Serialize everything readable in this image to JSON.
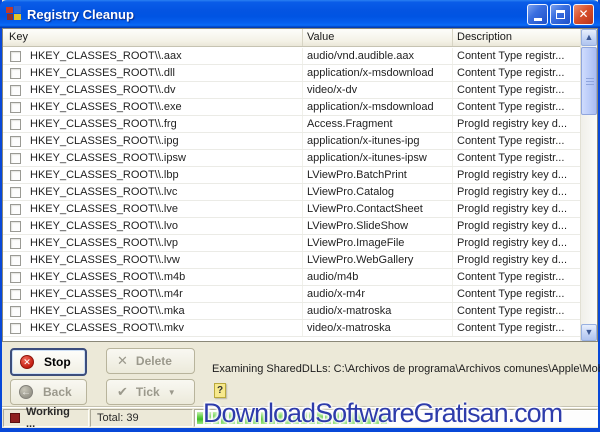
{
  "window": {
    "title": "Registry Cleanup"
  },
  "colors": {
    "titlebar_blue": "#0054e3",
    "window_border_blue": "#0848d8",
    "client_beige": "#ece9d8",
    "progress_green": "#46c42e",
    "close_button_red": "#d9512d",
    "watermark_blue": "#2e3cab",
    "working_dot_red": "#8e1f1f"
  },
  "icons": {
    "title_icon": "registry-blocks",
    "minimize": "minimize-icon",
    "maximize": "maximize-icon",
    "close_glyph": "✕",
    "stop_glyph": "✕",
    "back_glyph": "←",
    "delete_glyph": "✕",
    "tick_glyph": "✔",
    "tick_dropdown_glyph": "▼",
    "scroll_up_glyph": "▲",
    "scroll_down_glyph": "▼",
    "help_glyph": "?"
  },
  "table": {
    "columns": [
      "Key",
      "Value",
      "Description"
    ],
    "rows": [
      {
        "key": "HKEY_CLASSES_ROOT\\\\.aax",
        "value": "audio/vnd.audible.aax",
        "desc": "Content Type registr..."
      },
      {
        "key": "HKEY_CLASSES_ROOT\\\\.dll",
        "value": "application/x-msdownload",
        "desc": "Content Type registr..."
      },
      {
        "key": "HKEY_CLASSES_ROOT\\\\.dv",
        "value": "video/x-dv",
        "desc": "Content Type registr..."
      },
      {
        "key": "HKEY_CLASSES_ROOT\\\\.exe",
        "value": "application/x-msdownload",
        "desc": "Content Type registr..."
      },
      {
        "key": "HKEY_CLASSES_ROOT\\\\.frg",
        "value": "Access.Fragment",
        "desc": "ProgId registry key d..."
      },
      {
        "key": "HKEY_CLASSES_ROOT\\\\.ipg",
        "value": "application/x-itunes-ipg",
        "desc": "Content Type registr..."
      },
      {
        "key": "HKEY_CLASSES_ROOT\\\\.ipsw",
        "value": "application/x-itunes-ipsw",
        "desc": "Content Type registr..."
      },
      {
        "key": "HKEY_CLASSES_ROOT\\\\.lbp",
        "value": "LViewPro.BatchPrint",
        "desc": "ProgId registry key d..."
      },
      {
        "key": "HKEY_CLASSES_ROOT\\\\.lvc",
        "value": "LViewPro.Catalog",
        "desc": "ProgId registry key d..."
      },
      {
        "key": "HKEY_CLASSES_ROOT\\\\.lve",
        "value": "LViewPro.ContactSheet",
        "desc": "ProgId registry key d..."
      },
      {
        "key": "HKEY_CLASSES_ROOT\\\\.lvo",
        "value": "LViewPro.SlideShow",
        "desc": "ProgId registry key d..."
      },
      {
        "key": "HKEY_CLASSES_ROOT\\\\.lvp",
        "value": "LViewPro.ImageFile",
        "desc": "ProgId registry key d..."
      },
      {
        "key": "HKEY_CLASSES_ROOT\\\\.lvw",
        "value": "LViewPro.WebGallery",
        "desc": "ProgId registry key d..."
      },
      {
        "key": "HKEY_CLASSES_ROOT\\\\.m4b",
        "value": "audio/m4b",
        "desc": "Content Type registr..."
      },
      {
        "key": "HKEY_CLASSES_ROOT\\\\.m4r",
        "value": "audio/x-m4r",
        "desc": "Content Type registr..."
      },
      {
        "key": "HKEY_CLASSES_ROOT\\\\.mka",
        "value": "audio/x-matroska",
        "desc": "Content Type registr..."
      },
      {
        "key": "HKEY_CLASSES_ROOT\\\\.mkv",
        "value": "video/x-matroska",
        "desc": "Content Type registr..."
      }
    ]
  },
  "buttons": {
    "stop": "Stop",
    "delete": "Delete",
    "back": "Back",
    "tick": "Tick"
  },
  "status": {
    "message": "Examining SharedDLLs: C:\\Archivos de programa\\Archivos comunes\\Apple\\Mobile",
    "working_label": "Working ...",
    "total_label": "Total: 39",
    "progress_percent": 48
  },
  "watermark": {
    "text": "DownloadSoftwareGratisan.com"
  }
}
